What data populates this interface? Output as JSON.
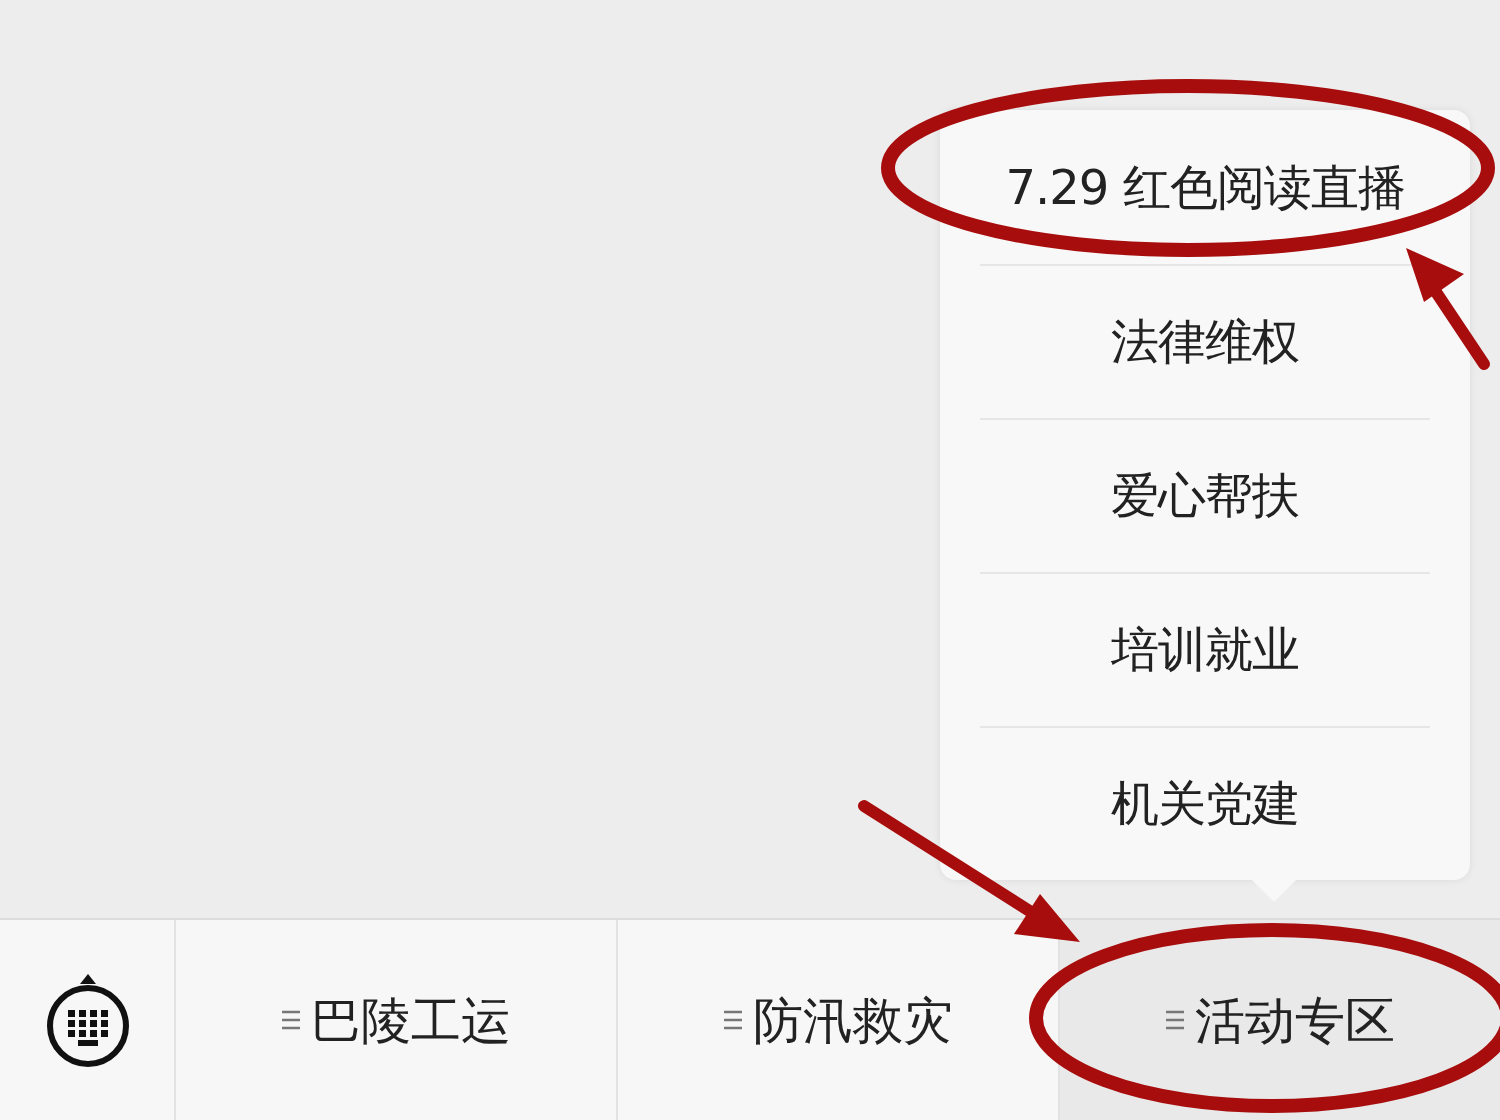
{
  "menus": [
    {
      "label": "巴陵工运",
      "open": false
    },
    {
      "label": "防汛救灾",
      "open": false
    },
    {
      "label": "活动专区",
      "open": true,
      "items": [
        {
          "label": "7.29 红色阅读直播"
        },
        {
          "label": "法律维权"
        },
        {
          "label": "爱心帮扶"
        },
        {
          "label": "培训就业"
        },
        {
          "label": "机关党建"
        }
      ]
    }
  ]
}
